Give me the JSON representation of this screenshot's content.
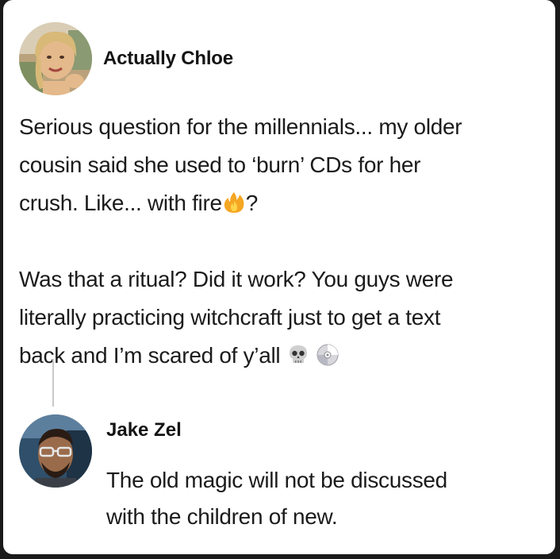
{
  "post": {
    "author": "Actually Chloe",
    "avatar_icon": "profile-photo-woman",
    "lines": [
      "Serious question for the millennials... my older",
      "cousin said she used to ‘burn’ CDs for her",
      "crush. Like... with fire"
    ],
    "line3_suffix": "?",
    "lines2": [
      "Was that a ritual? Did it work? You guys were",
      "literally practicing witchcraft just to get a text",
      "back and I’m scared of y’all"
    ],
    "emoji_fire": "fire-emoji",
    "emoji_skull": "skull-emoji",
    "emoji_disc": "cd-emoji"
  },
  "reply": {
    "author": "Jake Zel",
    "avatar_icon": "profile-photo-man",
    "lines": [
      "The old magic will not be discussed",
      "with the children of new."
    ]
  }
}
